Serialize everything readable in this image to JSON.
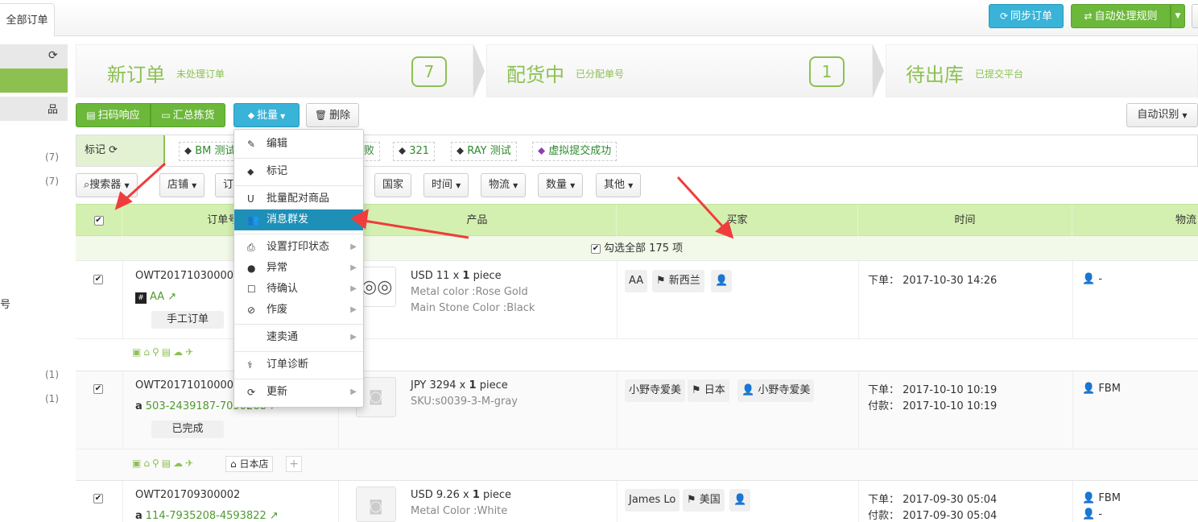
{
  "tabs": {
    "all_orders": "全部订单"
  },
  "header": {
    "sync_label": "同步订单",
    "auto_rules_label": "自动处理规则"
  },
  "sidebar": {
    "counts": [
      "(7)",
      "(7)",
      "(1)",
      "(1)"
    ],
    "edge_text": "号"
  },
  "steps": [
    {
      "title": "新订单",
      "subtitle": "未处理订单",
      "count": "7"
    },
    {
      "title": "配货中",
      "subtitle": "已分配单号",
      "count": "1"
    },
    {
      "title": "待出库",
      "subtitle": "已提交平台"
    }
  ],
  "toolbar": {
    "scan_label": "扫码响应",
    "summary_label": "汇总拣货",
    "batch_label": "批量",
    "delete_label": "删除",
    "auto_identify_label": "自动识别"
  },
  "tag_bar": {
    "label": "标记",
    "tags": [
      {
        "text": "BM 测试",
        "color": "#333333"
      },
      {
        "text": "败",
        "color": "#333333"
      },
      {
        "text": "321",
        "color": "#333333"
      },
      {
        "text": "RAY 测试",
        "color": "#333333"
      },
      {
        "text": "虚拟提交成功",
        "color": "#8e3fb0"
      }
    ]
  },
  "filters": [
    "搜索器",
    "店铺",
    "订",
    "国家",
    "时间",
    "物流",
    "数量",
    "其他"
  ],
  "table": {
    "headers": {
      "order": "订单号/平",
      "product": "产品",
      "buyer": "买家",
      "time": "时间",
      "logistics": "物流"
    },
    "select_all": "勾选全部 175 项",
    "rows": [
      {
        "order_id": "OWT201710300001",
        "account": "AA",
        "status": "手工订单",
        "price": "USD 11 x",
        "qty": "1",
        "unit": "piece",
        "attr1": "Metal color :Rose Gold",
        "attr2": "Main Stone Color :Black",
        "buyer_chips": [
          "AA",
          "新西兰",
          ""
        ],
        "time1": "下单： 2017-10-30 14:26",
        "time2": "",
        "logistics": "-",
        "logistics2": ""
      },
      {
        "order_id": "OWT201710100001",
        "account": "503-2439187-7050268",
        "status": "已完成",
        "price": "JPY 3294 x",
        "qty": "1",
        "unit": "piece",
        "attr1": "SKU:s0039-3-M-gray",
        "attr2": "",
        "buyer_chips": [
          "小野寺爱美",
          "日本",
          "小野寺爱美"
        ],
        "time1": "下单： 2017-10-10 10:19",
        "time2": "付款： 2017-10-10 10:19",
        "logistics": "FBM",
        "logistics2": "",
        "shop": "日本店"
      },
      {
        "order_id": "OWT201709300002",
        "account": "114-7935208-4593822",
        "status": "",
        "price": "USD 9.26 x",
        "qty": "1",
        "unit": "piece",
        "attr1": "Metal Color :White",
        "attr2": "",
        "buyer_chips": [
          "James Lo",
          "美国",
          ""
        ],
        "time1": "下单： 2017-09-30 05:04",
        "time2": "付款： 2017-09-30 05:04",
        "logistics": "FBM",
        "logistics2": "-"
      }
    ]
  },
  "batch_menu": [
    {
      "label": "编辑",
      "icon": "edit-icon",
      "submenu": false
    },
    {
      "label": "标记",
      "icon": "tag-icon",
      "submenu": false
    },
    {
      "label": "批量配对商品",
      "icon": "magnet-icon",
      "submenu": false
    },
    {
      "label": "消息群发",
      "icon": "group-icon",
      "submenu": false,
      "active": true
    },
    {
      "label": "设置打印状态",
      "icon": "print-icon",
      "submenu": true
    },
    {
      "label": "异常",
      "icon": "alert-icon",
      "submenu": true
    },
    {
      "label": "待确认",
      "icon": "checkbox-icon",
      "submenu": true
    },
    {
      "label": "作废",
      "icon": "ban-icon",
      "submenu": true
    },
    {
      "label": "速卖通",
      "icon": "",
      "submenu": true
    },
    {
      "label": "订单诊断",
      "icon": "diagnose-icon",
      "submenu": false
    },
    {
      "label": "更新",
      "icon": "refresh-icon",
      "submenu": true
    }
  ],
  "colors": {
    "accent_green": "#8cc152",
    "header_green": "#d4f0b0",
    "button_blue": "#39b3d7",
    "menu_active": "#1e90b8",
    "annotation_red": "#f03c3c"
  }
}
